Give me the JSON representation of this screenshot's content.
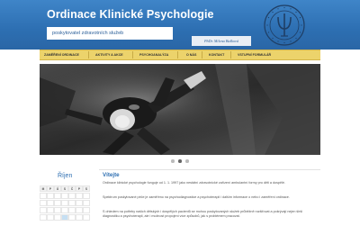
{
  "header": {
    "title": "Ordinace Klinické Psychologie",
    "subtitle": "poskytovatel zdravotních služeb",
    "signature": "PhDr. Milena Bušková"
  },
  "nav": {
    "items": [
      {
        "label": "ZAMĚŘENÍ ORDINACE"
      },
      {
        "label": "AKTIVITY A AKCE"
      },
      {
        "label": "PSYCHOANALÝZA"
      },
      {
        "label": "O NÁS"
      },
      {
        "label": "KONTAKT"
      },
      {
        "label": "VSTUPNÍ FORMULÁŘ"
      }
    ]
  },
  "slider": {
    "dots": 3,
    "active_dot": 2
  },
  "calendar": {
    "month": "Říjen",
    "weekdays": [
      "M",
      "P",
      "Ú",
      "S",
      "Č",
      "P",
      "S"
    ],
    "rows": [
      [
        "",
        "",
        "",
        "",
        "",
        "",
        ""
      ],
      [
        "",
        "",
        "",
        "",
        "",
        "",
        ""
      ],
      [
        "",
        "",
        "",
        "",
        "",
        "",
        ""
      ],
      [
        "",
        "",
        "",
        "",
        "",
        "",
        ""
      ]
    ]
  },
  "content": {
    "heading": "Vítejte",
    "paragraphs": [
      "Ordinace klinické psychologie funguje od 1. 1. 1997 jako nestátní zdravotnické zařízení ambulantní formy pro děti a dospělé.",
      "Spektrum poskytované péče je zaměřeno na psychodiagnostice a psychoterapii i dalším informace o nebo i zaměření ordinace.",
      "S ohledem na potřeby našich dětských i dospělých pacientů se mohou poskytovaných služeb průběžně rozšiřovat a pokrývají nejen širší diagnostiku a psychoterapii, ale i možnost propojení více způsobů, jak s problémem pracovat."
    ]
  },
  "colors": {
    "header_blue": "#2d6fb2",
    "nav_yellow": "#ecd36b",
    "accent_blue": "#2e6fb2"
  }
}
